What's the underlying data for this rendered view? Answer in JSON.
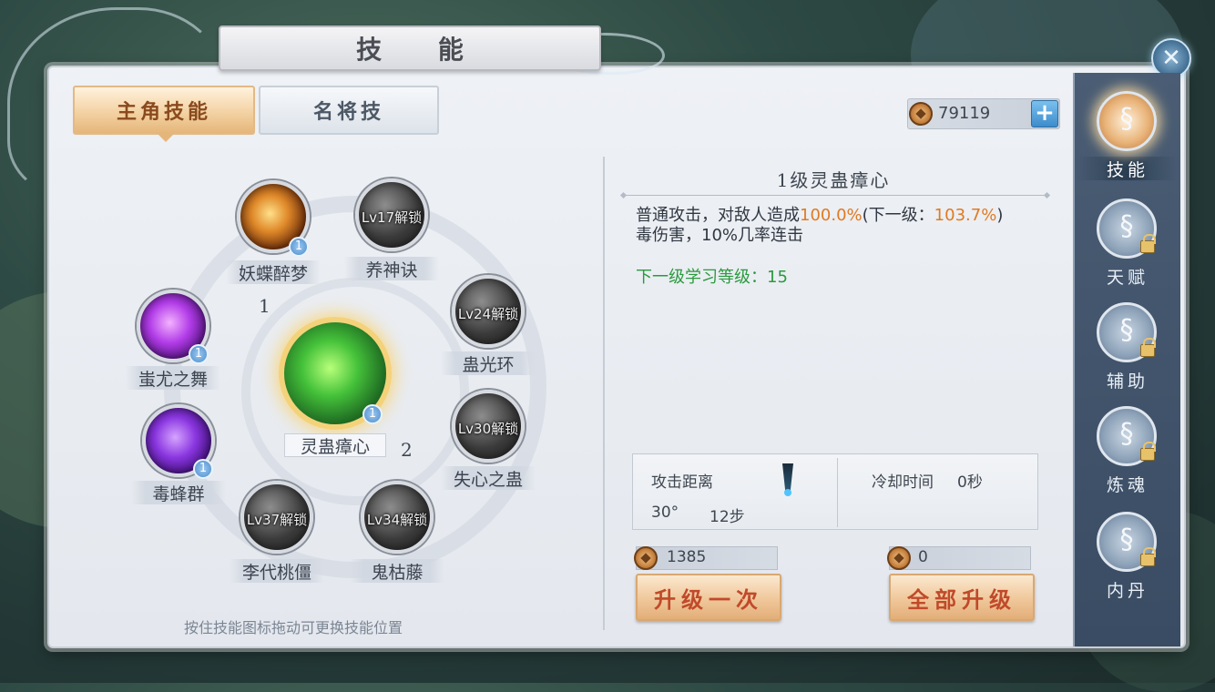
{
  "title": "技 能",
  "tabs": [
    {
      "label": "主角技能",
      "active": true
    },
    {
      "label": "名将技",
      "active": false
    }
  ],
  "currency": {
    "icon": "copper-coin-icon",
    "value": "79119",
    "add_icon": "plus-icon"
  },
  "skills": [
    {
      "name": "妖蝶醉梦",
      "lock": "",
      "badge": "1",
      "icon": "butterfly-skill-icon"
    },
    {
      "name": "养神诀",
      "lock": "Lv17解锁",
      "badge": "",
      "icon": "locked-skill-icon"
    },
    {
      "name": "蚩尤之舞",
      "lock": "",
      "badge": "1",
      "icon": "purple-dance-skill-icon"
    },
    {
      "name": "蛊光环",
      "lock": "Lv24解锁",
      "badge": "",
      "icon": "locked-skill-icon"
    },
    {
      "name": "灵蛊瘴心",
      "lock": "",
      "badge": "1",
      "icon": "green-bird-skill-icon"
    },
    {
      "name": "失心之蛊",
      "lock": "Lv30解锁",
      "badge": "",
      "icon": "locked-skill-icon"
    },
    {
      "name": "毒蜂群",
      "lock": "",
      "badge": "1",
      "icon": "purple-wasp-skill-icon"
    },
    {
      "name": "李代桃僵",
      "lock": "Lv37解锁",
      "badge": "",
      "icon": "locked-skill-icon"
    },
    {
      "name": "鬼枯藤",
      "lock": "Lv34解锁",
      "badge": "",
      "icon": "locked-skill-icon"
    }
  ],
  "slot_numbers": {
    "one": "1",
    "two": "2"
  },
  "hint": "按住技能图标拖动可更换技能位置",
  "detail": {
    "title": "1级灵蛊瘴心",
    "desc_part1": "普通攻击，对敌人造成",
    "desc_value": "100.0%",
    "desc_part2": "(下一级：",
    "desc_next": "103.7%",
    "desc_part3": ")",
    "desc_line2": "毒伤害，10%几率连击",
    "next_level": "下一级学习等级：15",
    "attack_range_label": "攻击距离",
    "attack_angle": "30°",
    "attack_steps": "12步",
    "cooldown_label": "冷却时间",
    "cooldown_value": "0秒"
  },
  "costs": {
    "once": "1385",
    "all": "0"
  },
  "buttons": {
    "upgrade_once": "升级一次",
    "upgrade_all": "全部升级"
  },
  "sidebar": [
    {
      "label": "技能",
      "active": true,
      "locked": false,
      "icon": "dragon-emblem-icon"
    },
    {
      "label": "天赋",
      "active": false,
      "locked": true,
      "icon": "dragon-emblem-icon"
    },
    {
      "label": "辅助",
      "active": false,
      "locked": true,
      "icon": "dragon-emblem-icon"
    },
    {
      "label": "炼魂",
      "active": false,
      "locked": true,
      "icon": "dragon-emblem-icon"
    },
    {
      "label": "内丹",
      "active": false,
      "locked": true,
      "icon": "dragon-emblem-icon"
    }
  ],
  "colors": {
    "accent": "#e07a21",
    "green": "#2a9a3e",
    "tab_active": "#f2cf9e",
    "sidebar": "#4a5d74"
  }
}
